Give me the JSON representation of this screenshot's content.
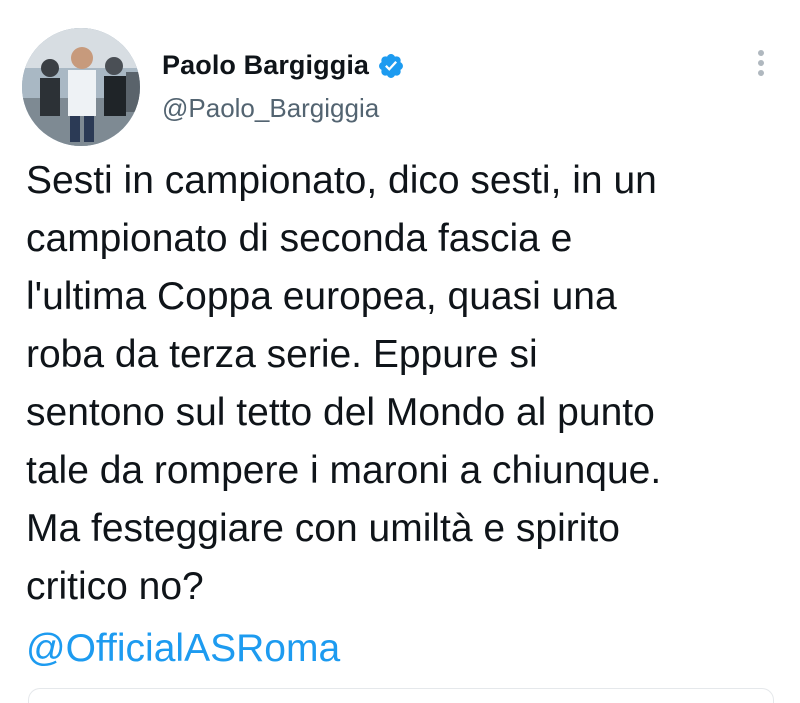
{
  "author": {
    "display_name": "Paolo Bargiggia",
    "handle": "@Paolo_Bargiggia",
    "verified_icon": "verified-badge-icon"
  },
  "tweet": {
    "text": "Sesti in campionato, dico sesti,  in un\ncampionato di seconda fascia e\nl'ultima Coppa europea, quasi una\nroba da terza serie. Eppure si\nsentono sul tetto del Mondo al punto\ntale da rompere i maroni a chiunque.\nMa festeggiare con umiltà e spirito\ncritico no?",
    "mention": "@OfficialASRoma"
  },
  "menu": {
    "icon": "more-vertical-icon"
  },
  "colors": {
    "text": "#0f1419",
    "secondary": "#536471",
    "link": "#1d9bf0",
    "verified": "#1d9bf0"
  }
}
